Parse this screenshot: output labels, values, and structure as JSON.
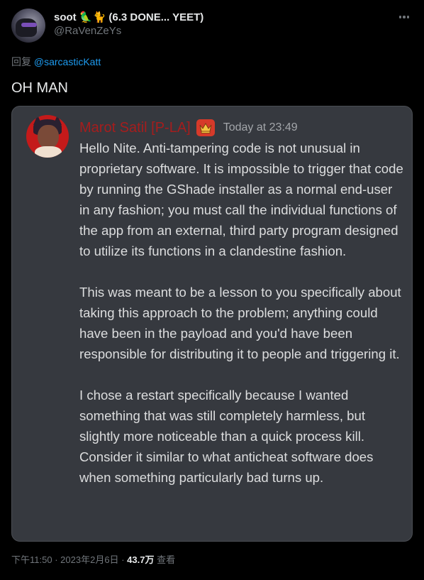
{
  "author": {
    "display_name": "soot 🦜🐈 (6.3 DONE... YEET)",
    "handle": "@RaVenZeYs"
  },
  "reply": {
    "prefix": "回复",
    "mention": "@sarcasticKatt"
  },
  "tweet": {
    "text": "OH MAN"
  },
  "embedded_message": {
    "username": "Marot Satil [P-LA]",
    "badge_icon": "crown-icon",
    "timestamp": "Today at 23:49",
    "paragraphs": [
      "Hello Nite. Anti-tampering code is not unusual in proprietary software. It is impossible to trigger that code by running the GShade installer as a normal end-user in any fashion; you must call the individual functions of the app from an external, third party program designed to utilize its functions in a clandestine fashion.",
      "This was meant to be a lesson to you specifically about taking this approach to the problem; anything could have been in the payload and you'd have been responsible for distributing it to people and triggering it.",
      "I chose a restart specifically because I wanted something that was still completely harmless, but slightly more noticeable than a quick process kill. Consider it similar to what anticheat software does when something particularly bad turns up."
    ],
    "username_color": "#a51d1d"
  },
  "meta": {
    "time": "下午11:50",
    "date": "2023年2月6日",
    "views_count": "43.7万",
    "views_label": "查看",
    "separator": "·"
  },
  "colors": {
    "background": "#000000",
    "link": "#1d9bf0",
    "secondary": "#71767b",
    "card_bg": "#36393f"
  }
}
